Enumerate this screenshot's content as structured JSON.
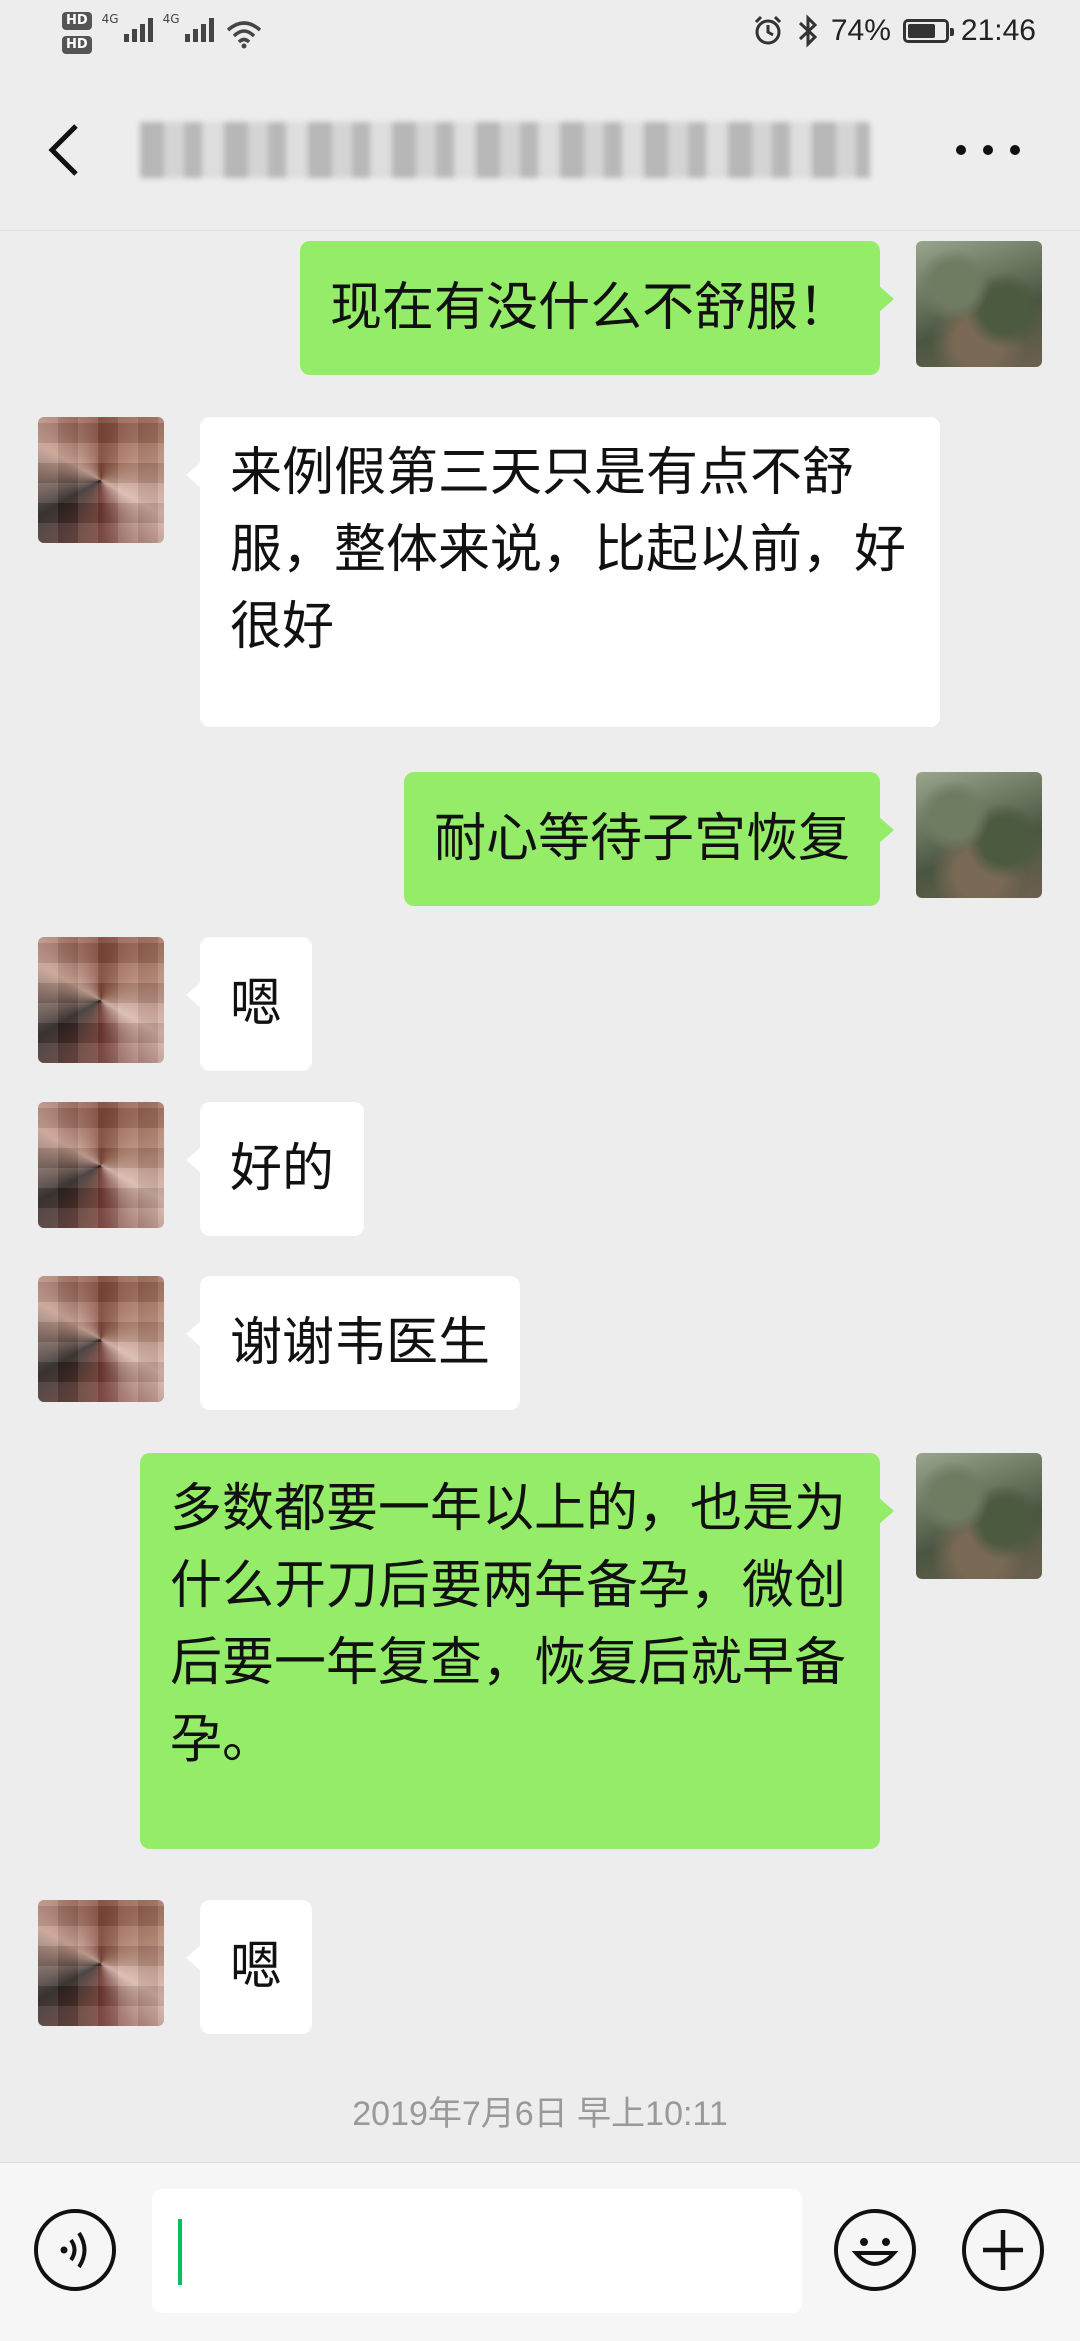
{
  "status_bar": {
    "hd1": "HD",
    "hd2": "HD",
    "signal1": "4G",
    "signal2": "4G",
    "battery_percent": "74%",
    "battery_level": 0.74,
    "time": "21:46",
    "icons": [
      "alarm-icon",
      "bluetooth-icon",
      "wifi-icon",
      "battery-icon"
    ]
  },
  "header": {
    "back_icon": "chevron-left-icon",
    "title": "",
    "more_icon": "more-dots-icon"
  },
  "messages": [
    {
      "sender": "me",
      "text": "现在有没什么不舒服！"
    },
    {
      "sender": "other",
      "text": "来例假第三天只是有点不舒服，整体来说，比起以前，好很好"
    },
    {
      "sender": "me",
      "text": "耐心等待子宫恢复"
    },
    {
      "sender": "other",
      "text": "嗯"
    },
    {
      "sender": "other",
      "text": "好的"
    },
    {
      "sender": "other",
      "text": "谢谢韦医生"
    },
    {
      "sender": "me",
      "text": "多数都要一年以上的，也是为什么开刀后要两年备孕，微创后要一年复查，恢复后就早备孕。"
    },
    {
      "sender": "other",
      "text": "嗯"
    }
  ],
  "timestamp": "2019年7月6日 早上10:11",
  "input_bar": {
    "voice_icon": "voice-icon",
    "input_value": "",
    "emoji_icon": "emoji-icon",
    "plus_icon": "plus-icon"
  },
  "colors": {
    "background": "#ededed",
    "my_bubble": "#95ec69",
    "other_bubble": "#ffffff",
    "caret": "#07c160"
  }
}
